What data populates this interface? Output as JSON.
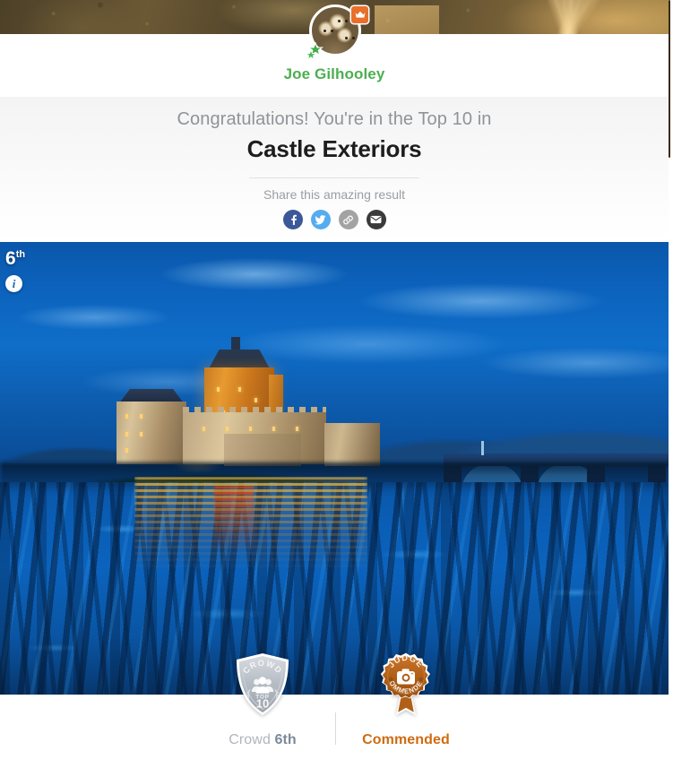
{
  "profile": {
    "name": "Joe Gilhooley",
    "avatar_alt": "owls-photo-avatar",
    "crown_icon": "crown-icon",
    "stars_icon": "green-stars-icon"
  },
  "congrats": {
    "line": "Congratulations! You're in the Top 10 in",
    "contest_title": "Castle Exteriors",
    "share_label": "Share this amazing result",
    "share_buttons": [
      {
        "name": "facebook-share-button",
        "icon": "facebook-icon",
        "color": "#3b5998"
      },
      {
        "name": "twitter-share-button",
        "icon": "twitter-icon",
        "color": "#55acee"
      },
      {
        "name": "copy-link-button",
        "icon": "link-icon",
        "color": "#a3a3a3"
      },
      {
        "name": "email-share-button",
        "icon": "email-icon",
        "color": "#3a3a3a"
      }
    ]
  },
  "photo": {
    "rank_number": "6",
    "rank_suffix": "th",
    "info_icon": "info-icon",
    "subject_alt": "castle-at-blue-hour-reflected-in-water"
  },
  "awards": [
    {
      "badge_name": "crowd-top-10-badge",
      "badge_top_text": "CROWD",
      "badge_mid_text": "TOP",
      "badge_bottom_text": "10",
      "label_prefix": "Crowd ",
      "label_rank": "6th",
      "label_color": "#7c8a99"
    },
    {
      "badge_name": "judge-commended-badge",
      "badge_top_text": "JUDGE",
      "badge_bottom_text": "COMMENDED",
      "badge_icon": "camera-icon",
      "label": "Commended",
      "label_color": "#cf6c11"
    }
  ],
  "theme": {
    "brand_green": "#4caf50",
    "accent_orange": "#e8702a",
    "judge_orange": "#b9621a",
    "crowd_silver": "#b9bfc6"
  }
}
